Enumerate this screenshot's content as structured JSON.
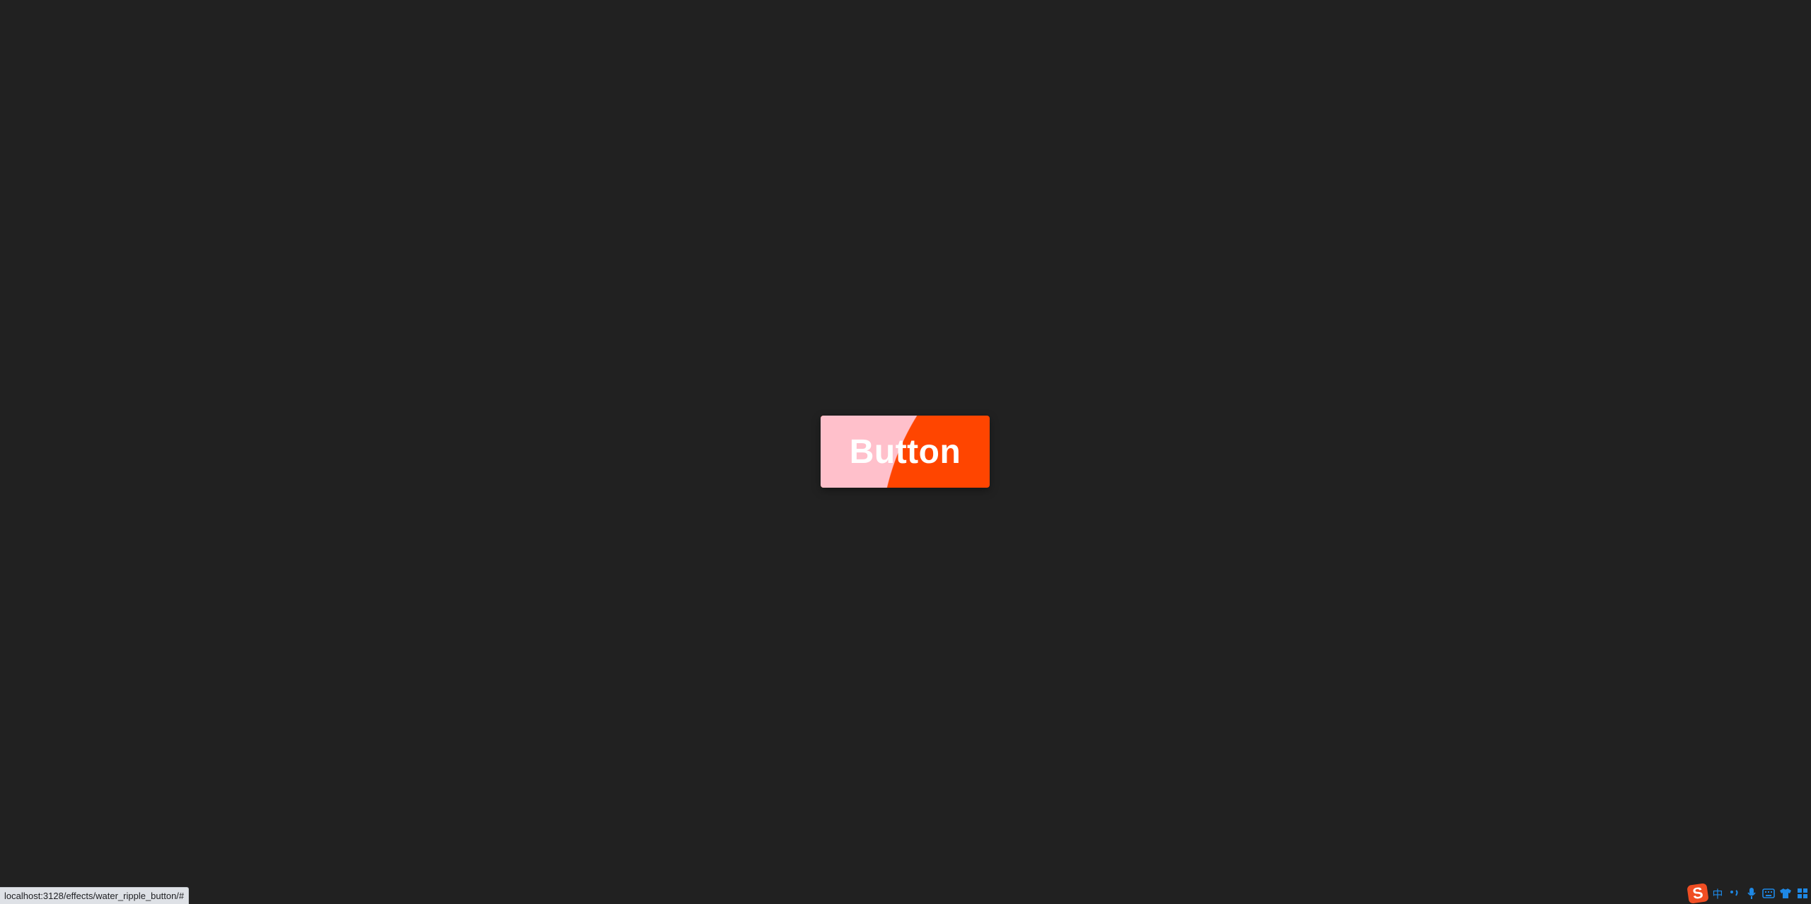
{
  "main": {
    "button_label": "Button"
  },
  "status_bar": {
    "url": "localhost:3128/effects/water_ripple_button/#"
  },
  "ime_toolbar": {
    "logo_text": "S",
    "language_label": "中",
    "icons": [
      "punctuation-icon",
      "microphone-icon",
      "keyboard-icon",
      "skin-icon",
      "toolbox-icon"
    ]
  },
  "colors": {
    "background": "#212121",
    "button_primary": "#ff4500",
    "ripple_pink": "#ffc0cb",
    "button_text": "#ffffff",
    "ime_accent": "#1e88e5",
    "ime_logo": "#f04e23"
  }
}
